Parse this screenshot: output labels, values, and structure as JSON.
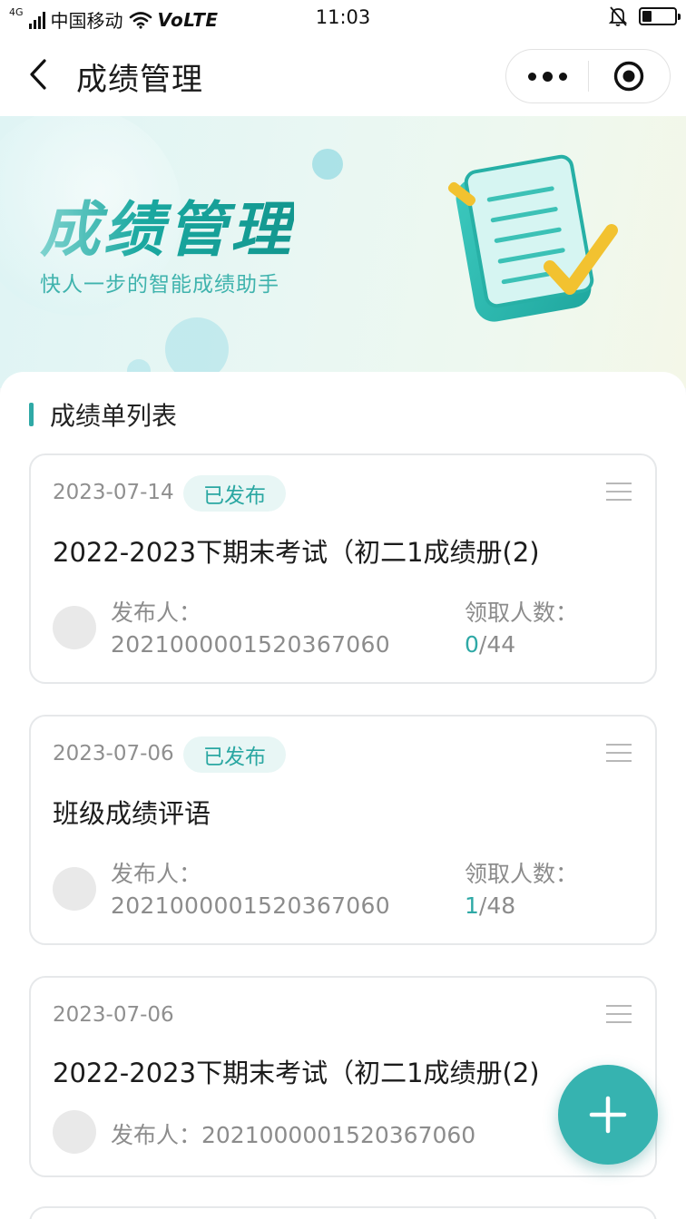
{
  "status_bar": {
    "network_type": "4G",
    "carrier": "中国移动",
    "volte": "VoLTE",
    "time": "11:03",
    "battery_level": 0.3
  },
  "nav": {
    "title": "成绩管理",
    "icons": {
      "back": "chevron-left-icon",
      "more": "more-dots-icon",
      "close": "target-close-icon"
    }
  },
  "banner": {
    "title": "成绩管理",
    "subtitle": "快人一步的智能成绩助手"
  },
  "section": {
    "title": "成绩单列表"
  },
  "cards": [
    {
      "date": "2023-07-14",
      "status": "已发布",
      "title": "2022-2023下期末考试（初二1成绩册(2)",
      "publisher_label": "发布人：",
      "publisher_id": "2021000001520367060",
      "recv_label": "领取人数：",
      "recv_count": "0",
      "recv_total": "/44"
    },
    {
      "date": "2023-07-06",
      "status": "已发布",
      "title": "班级成绩评语",
      "publisher_label": "发布人：",
      "publisher_id": "2021000001520367060",
      "recv_label": "领取人数：",
      "recv_count": "1",
      "recv_total": "/48"
    },
    {
      "date": "2023-07-06",
      "title": "2022-2023下期末考试（初二1成绩册(2)",
      "publisher_inline": "发布人：2021000001520367060"
    }
  ],
  "colors": {
    "accent": "#36b3b0",
    "badge_bg": "#e8f6f5",
    "badge_text": "#2aa7a2"
  }
}
